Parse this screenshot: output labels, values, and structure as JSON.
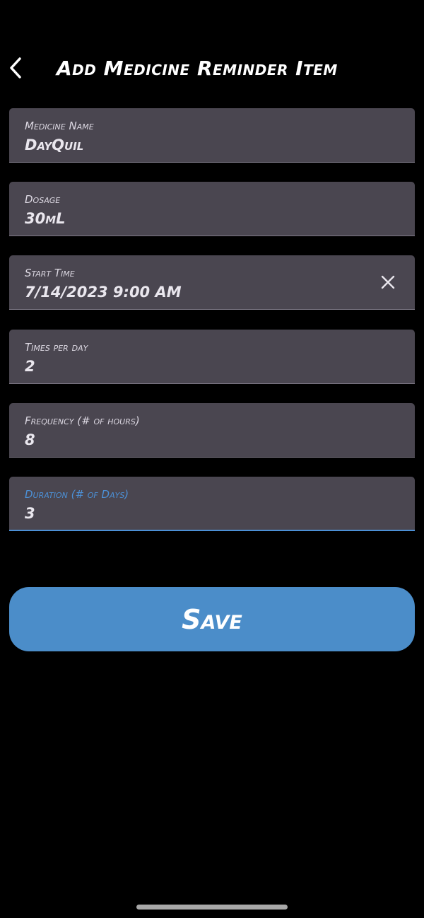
{
  "header": {
    "title": "Add Medicine Reminder Item",
    "back_icon": "chevron-left-icon"
  },
  "fields": [
    {
      "label": "Medicine Name",
      "value": "DayQuil"
    },
    {
      "label": "Dosage",
      "value": "30mL"
    },
    {
      "label": "Start Time",
      "value": "7/14/2023 9:00 AM",
      "clear_icon": "close-icon"
    },
    {
      "label": "Times per day",
      "value": "2"
    },
    {
      "label": "Frequency (# of hours)",
      "value": "8"
    },
    {
      "label": "Duration (# of Days)",
      "value": "3",
      "focused": true
    }
  ],
  "save_button": {
    "label": "Save"
  },
  "colors": {
    "background": "#000000",
    "field_background": "#4a4650",
    "accent": "#4b8dc9",
    "focus_label": "#4c90d6"
  }
}
